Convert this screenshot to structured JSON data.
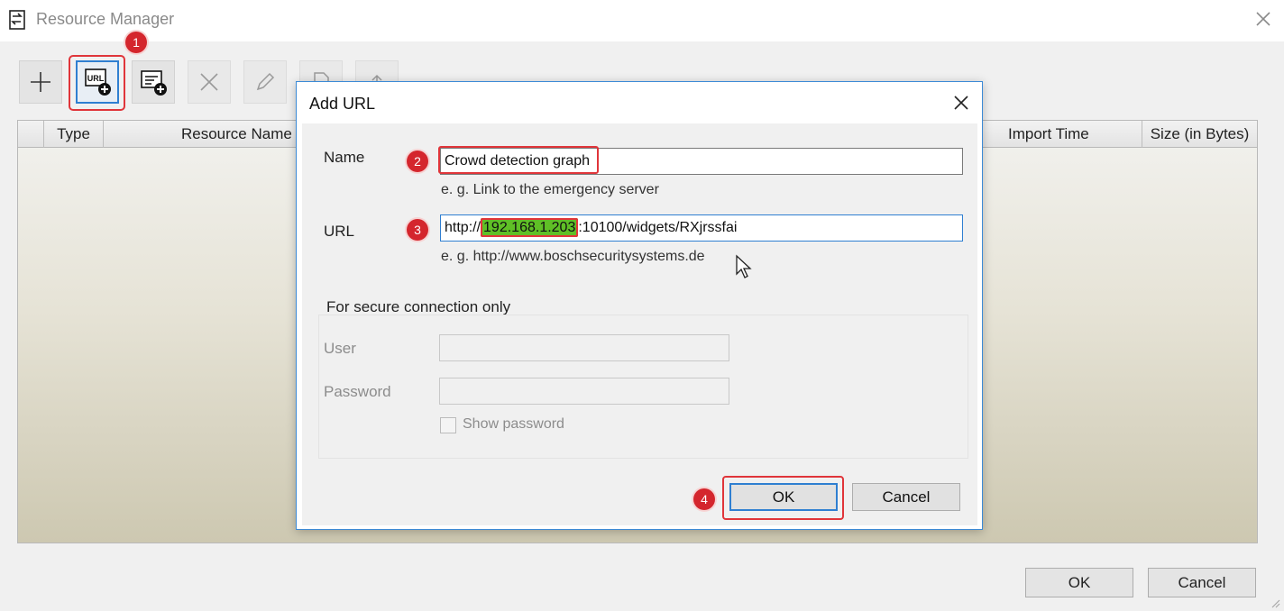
{
  "window": {
    "title": "Resource Manager"
  },
  "toolbar": {
    "buttons": [
      {
        "name": "add",
        "icon": "plus-icon",
        "enabled": true
      },
      {
        "name": "add-url",
        "icon": "url-plus-icon",
        "enabled": true,
        "icon_text": "URL"
      },
      {
        "name": "add-application",
        "icon": "list-plus-icon",
        "enabled": true
      },
      {
        "name": "delete",
        "icon": "x-icon",
        "enabled": false
      },
      {
        "name": "edit",
        "icon": "pencil-icon",
        "enabled": false
      },
      {
        "name": "replace",
        "icon": "document-icon",
        "enabled": false
      },
      {
        "name": "export",
        "icon": "upload-icon",
        "enabled": false
      }
    ]
  },
  "list": {
    "columns": [
      "Type",
      "Resource Name",
      "Import Time",
      "Size (in Bytes)"
    ]
  },
  "footer": {
    "ok_label": "OK",
    "cancel_label": "Cancel"
  },
  "dialog": {
    "title": "Add URL",
    "name_label": "Name",
    "name_value": "Crowd detection graph",
    "name_hint": "e. g. Link to the emergency server",
    "url_label": "URL",
    "url_prefix": "http://",
    "url_ip": "192.168.1.203",
    "url_suffix": ":10100/widgets/RXjrssfai",
    "url_hint": "e. g. http://www.boschsecuritysystems.de",
    "secure_label": "For secure connection only",
    "user_label": "User",
    "user_value": "",
    "password_label": "Password",
    "password_value": "",
    "show_password_label": "Show password",
    "show_password_checked": false,
    "ok_label": "OK",
    "cancel_label": "Cancel"
  },
  "annotations": {
    "step1": "1",
    "step2": "2",
    "step3": "3",
    "step4": "4",
    "highlight_color": "#e0353a",
    "ip_highlight_color": "#5fbf26"
  },
  "colors": {
    "accent": "#2f7fd1",
    "marker": "#d4262d"
  }
}
